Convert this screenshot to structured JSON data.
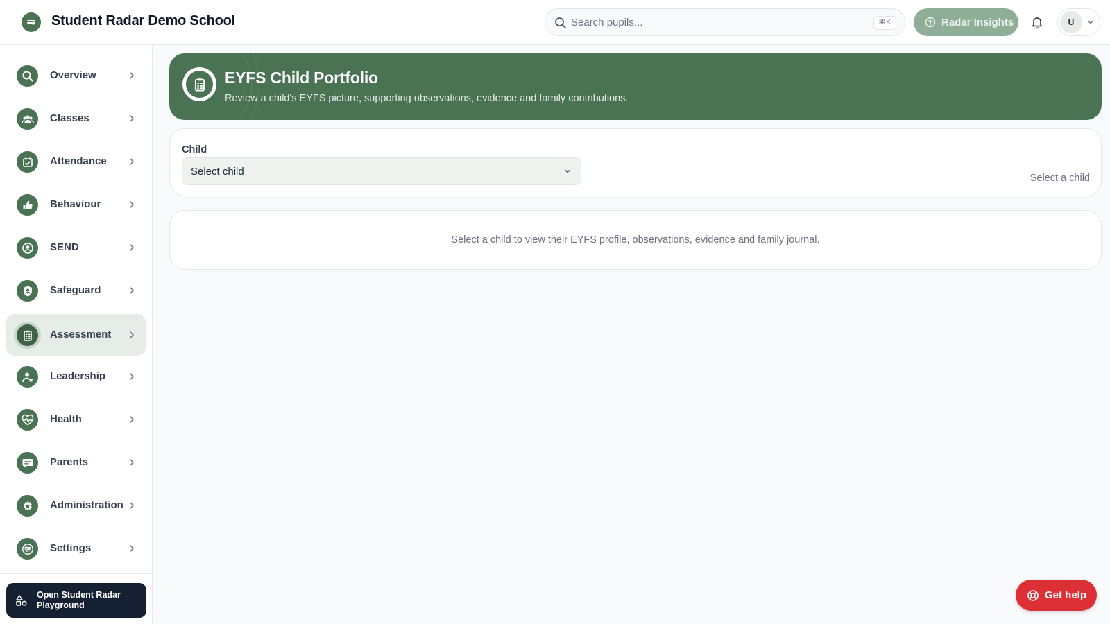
{
  "app": {
    "school_name": "Student Radar Demo School",
    "logo_icon": "radar-logo-icon"
  },
  "header": {
    "search": {
      "placeholder": "Search pupils...",
      "shortcut": "⌘K"
    },
    "insights_label": "Radar Insights",
    "user_initial": "U"
  },
  "sidebar": {
    "items": [
      {
        "label": "Overview",
        "icon": "search-icon"
      },
      {
        "label": "Classes",
        "icon": "people-icon"
      },
      {
        "label": "Attendance",
        "icon": "calendar-check-icon"
      },
      {
        "label": "Behaviour",
        "icon": "thumbs-up-icon"
      },
      {
        "label": "SEND",
        "icon": "user-circle-icon"
      },
      {
        "label": "Safeguard",
        "icon": "shield-user-icon"
      },
      {
        "label": "Assessment",
        "icon": "clipboard-icon",
        "active": true
      },
      {
        "label": "Leadership",
        "icon": "user-star-icon"
      },
      {
        "label": "Health",
        "icon": "heart-pulse-icon"
      },
      {
        "label": "Parents",
        "icon": "message-icon"
      },
      {
        "label": "Administration",
        "icon": "gear-icon"
      },
      {
        "label": "Settings",
        "icon": "sliders-icon"
      }
    ],
    "playground_label": "Open Student Radar Playground"
  },
  "hero": {
    "title": "EYFS Child Portfolio",
    "subtitle": "Review a child's EYFS picture, supporting observations, evidence and family contributions."
  },
  "child_picker": {
    "label": "Child",
    "selected": "Select child",
    "status": "Select a child"
  },
  "empty_state": {
    "message": "Select a child to view their EYFS profile, observations, evidence and family journal."
  },
  "help": {
    "label": "Get help"
  },
  "colors": {
    "brand_green": "#4a7354",
    "insights_green": "#8fae97",
    "help_red": "#dc2f36",
    "playground_navy": "#162033"
  }
}
